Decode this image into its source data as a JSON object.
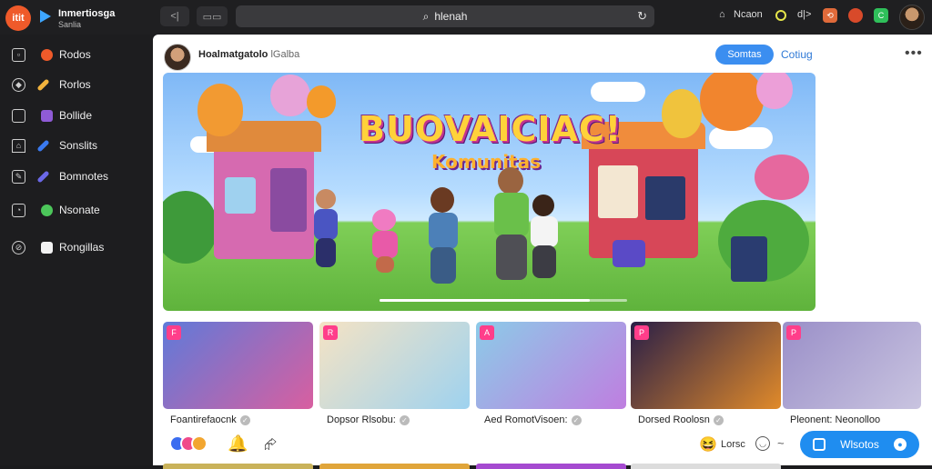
{
  "browser": {
    "app_logo_text": "itit",
    "brand_title": "Inmertiosga",
    "brand_sub": "Sanlia",
    "back_label": "<|",
    "fwd_label": "▭▭",
    "url_text": "hlenah",
    "right_items": {
      "home_label": "Ncaon",
      "audio_label": "d|>",
      "badge1": "⟲",
      "badge2": "C"
    }
  },
  "sidebar": {
    "items": [
      {
        "label": "Rodos",
        "icon": "grid-icon",
        "color": "#ef5a2a"
      },
      {
        "label": "Rorlos",
        "icon": "compass-icon",
        "color": "#f2b33d"
      },
      {
        "label": "Bollide",
        "icon": "square-icon",
        "color": "#8f5bd6"
      },
      {
        "label": "Sonslits",
        "icon": "home-icon",
        "color": "#3a7af0"
      },
      {
        "label": "Bomnotes",
        "icon": "pen-icon",
        "color": "#6b68e8"
      },
      {
        "label": "Nsonate",
        "icon": "image-icon",
        "color": "#4cc65a"
      },
      {
        "label": "Rongillas",
        "icon": "clock-icon",
        "color": "#f2f2f2"
      }
    ]
  },
  "post": {
    "author": "Hoalmatgatolo",
    "author_suffix": "lGalba",
    "follow_label": "Somtas",
    "config_label": "Cotiug",
    "more_label": "•••"
  },
  "hero": {
    "title": "BUOVAICIAC!",
    "subtitle": "Komunitas",
    "progress_fraction": 0.85
  },
  "thumbnails": [
    {
      "title": "Foantirefaocnk",
      "badge": "F",
      "colors": [
        "#5f7ad9",
        "#d85fa0"
      ]
    },
    {
      "title": "Dopsor Rlsobu:",
      "badge": "R",
      "colors": [
        "#f5e3c4",
        "#9ed2ef"
      ]
    },
    {
      "title": "Aed RomotVisoen:",
      "badge": "A",
      "colors": [
        "#8ccbe8",
        "#bf7ee0"
      ]
    },
    {
      "title": "Dorsed Roolosn",
      "badge": "P",
      "colors": [
        "#2a1f47",
        "#e08a2a"
      ]
    },
    {
      "title": "Pleonent: Neonolloo",
      "badge": "P",
      "colors": [
        "#9a8fc8",
        "#c9c4e0"
      ]
    }
  ],
  "bottom": {
    "react_label": "Lorsc",
    "watch_label": "Wlsotos",
    "emoji": "😆",
    "bell": "🔔",
    "share": "⮳"
  }
}
